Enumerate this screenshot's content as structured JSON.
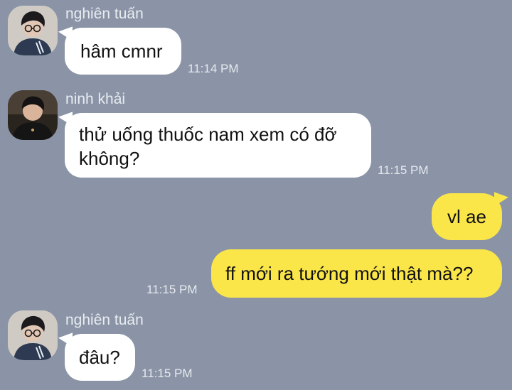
{
  "messages": [
    {
      "sender": "nghiên tuấn",
      "text": "hâm cmnr",
      "time": "11:14 PM",
      "direction": "incoming",
      "avatar_icon": "user-avatar-glasses"
    },
    {
      "sender": "ninh khải",
      "text_line1": "thử uống thuốc nam xem có đỡ",
      "text_line2": "không?",
      "time": "11:15 PM",
      "direction": "incoming",
      "avatar_icon": "user-avatar-dark-jacket"
    },
    {
      "text": "vl ae",
      "direction": "outgoing"
    },
    {
      "text": "ff mới ra tướng mới thật mà??",
      "time": "11:15 PM",
      "direction": "outgoing"
    },
    {
      "sender": "nghiên tuấn",
      "text": "đâu?",
      "time": "11:15 PM",
      "direction": "incoming",
      "avatar_icon": "user-avatar-glasses"
    }
  ],
  "colors": {
    "background": "#8a94a6",
    "incoming_bubble": "#ffffff",
    "outgoing_bubble": "#fbe64a",
    "meta_text": "#e6e9ee"
  }
}
